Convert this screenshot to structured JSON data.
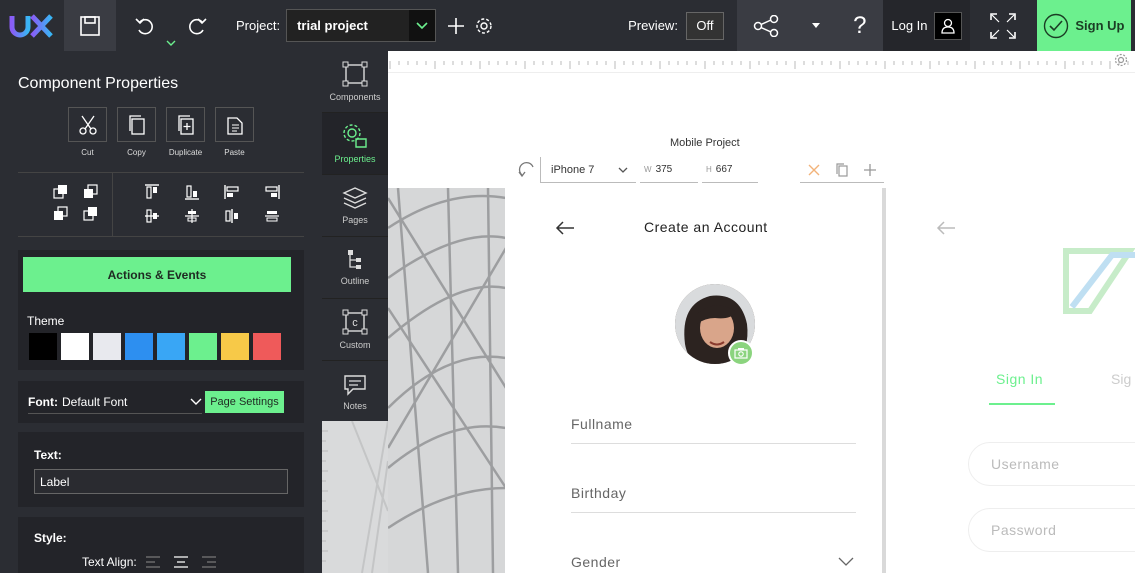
{
  "topbar": {
    "logo_text": "UX",
    "project_label": "Project:",
    "project_value": "trial project",
    "preview_label": "Preview:",
    "preview_value": "Off",
    "help_glyph": "?",
    "login_label": "Log In",
    "signup_label": "Sign Up"
  },
  "left_panel": {
    "title": "Component Properties",
    "clipboard": [
      {
        "label": "Cut",
        "icon": "scissors-icon"
      },
      {
        "label": "Copy",
        "icon": "copy-icon"
      },
      {
        "label": "Duplicate",
        "icon": "duplicate-icon"
      },
      {
        "label": "Paste",
        "icon": "paste-icon"
      }
    ],
    "actions_label": "Actions & Events",
    "theme_label": "Theme",
    "theme_colors": [
      "#000000",
      "#ffffff",
      "#e8e9ee",
      "#2d8ff0",
      "#39a6f5",
      "#6cf08e",
      "#f7c948",
      "#ef5a5a"
    ],
    "font_label": "Font:",
    "font_value": "Default Font",
    "page_settings_label": "Page Settings",
    "text_label": "Text:",
    "text_value": "Label",
    "style_label": "Style:",
    "text_align_label": "Text Align:"
  },
  "side_tabs": [
    {
      "label": "Components",
      "icon": "components-icon"
    },
    {
      "label": "Properties",
      "icon": "properties-icon",
      "active": true
    },
    {
      "label": "Pages",
      "icon": "pages-icon"
    },
    {
      "label": "Outline",
      "icon": "outline-icon"
    },
    {
      "label": "Custom",
      "icon": "custom-icon"
    },
    {
      "label": "Notes",
      "icon": "notes-icon"
    }
  ],
  "canvas": {
    "mobile_title": "Mobile Project",
    "device": "iPhone 7",
    "width_label": "W",
    "width_value": "375",
    "height_label": "H",
    "height_value": "667",
    "screen1": {
      "title": "Create an Account",
      "fields": [
        "Fullname",
        "Birthday",
        "Gender"
      ]
    },
    "screen2": {
      "tab_signin": "Sign In",
      "tab_signup": "Sig",
      "username_placeholder": "Username",
      "password_placeholder": "Password"
    }
  },
  "colors": {
    "accent": "#6cf08e",
    "panel": "#2b2d33"
  }
}
